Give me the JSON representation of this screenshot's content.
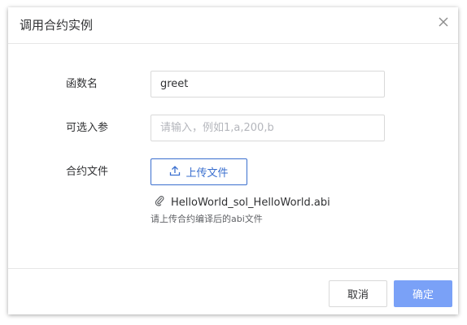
{
  "dialog": {
    "title": "调用合约实例",
    "close_icon": "close-icon"
  },
  "form": {
    "function_name": {
      "label": "函数名",
      "value": "greet"
    },
    "params": {
      "label": "可选入参",
      "value": "",
      "placeholder": "请输入，例如1,a,200,b"
    },
    "contract_file": {
      "label": "合约文件",
      "upload_label": "上传文件",
      "upload_icon": "upload-icon",
      "attachment_icon": "paperclip-icon",
      "file_name": "HelloWorld_sol_HelloWorld.abi",
      "hint": "请上传合约编译后的abi文件"
    }
  },
  "footer": {
    "cancel_label": "取消",
    "confirm_label": "确定"
  },
  "colors": {
    "primary": "#3a6fcf",
    "confirm_button": "#7aa1f7",
    "border": "#d9d9d9"
  }
}
